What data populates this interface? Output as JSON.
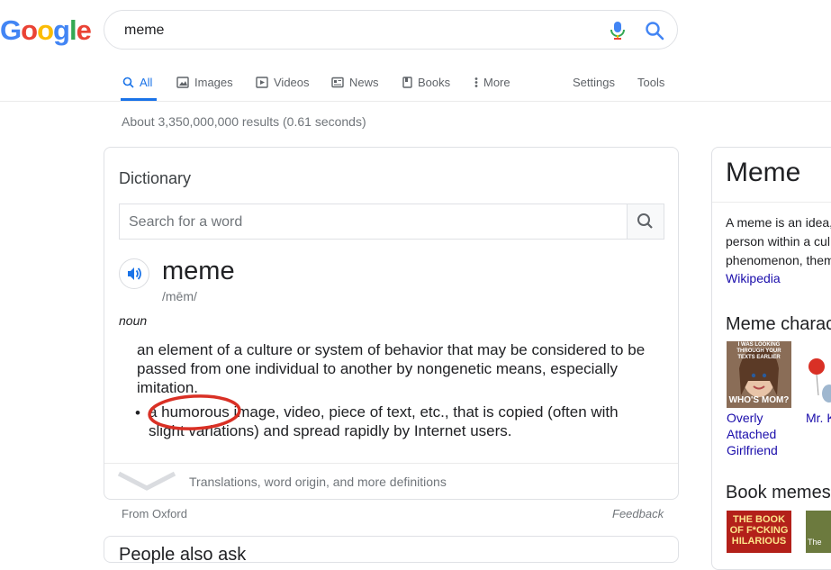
{
  "logo": {
    "letters": [
      "G",
      "o",
      "o",
      "g",
      "l",
      "e"
    ],
    "colors": [
      "#4285F4",
      "#EA4335",
      "#FBBC05",
      "#4285F4",
      "#34A853",
      "#EA4335"
    ]
  },
  "search": {
    "query": "meme"
  },
  "tabs": [
    {
      "label": "All",
      "icon": "search-icon",
      "active": true
    },
    {
      "label": "Images",
      "icon": "image-icon"
    },
    {
      "label": "Videos",
      "icon": "play-icon"
    },
    {
      "label": "News",
      "icon": "news-icon"
    },
    {
      "label": "Books",
      "icon": "book-icon"
    },
    {
      "label": "More",
      "icon": "more-dots-icon"
    },
    {
      "label": "Settings"
    },
    {
      "label": "Tools"
    }
  ],
  "results_stats": "About 3,350,000,000 results (0.61 seconds)",
  "dictionary": {
    "title": "Dictionary",
    "search_placeholder": "Search for a word",
    "word": "meme",
    "phonetic": "/mēm/",
    "part_of_speech": "noun",
    "definition_1": "an element of a culture or system of behavior that may be considered to be passed from one individual to another by nongenetic means, especially imitation.",
    "definition_2": "a humorous image, video, piece of text, etc., that is copied (often with slight variations) and spread rapidly by Internet users.",
    "more_link": "Translations, word origin, and more definitions",
    "source": "From Oxford",
    "feedback": "Feedback"
  },
  "next_card_title": "People also ask",
  "knowledge_panel": {
    "title": "Meme",
    "description_lines": [
      "A meme is an idea,",
      "person within a cul",
      "phenomenon, them"
    ],
    "wiki_link": "Wikipedia",
    "characters_heading": "Meme charac",
    "character_1": {
      "label_lines": [
        "Overly",
        "Attached",
        "Girlfriend"
      ],
      "image_text_top": "I WAS LOOKING THROUGH YOUR TEXTS EARLIER",
      "image_text_bottom": "WHO'S MOM?"
    },
    "character_2": {
      "label": "Mr. K"
    },
    "books_heading": "Book memes",
    "book_1_text": "THE BOOK OF F*CKING HILARIOUS",
    "book_2_text": "The"
  },
  "colors": {
    "accent": "#1a73e8",
    "link": "#1a0dab",
    "annotation": "#d93025"
  }
}
